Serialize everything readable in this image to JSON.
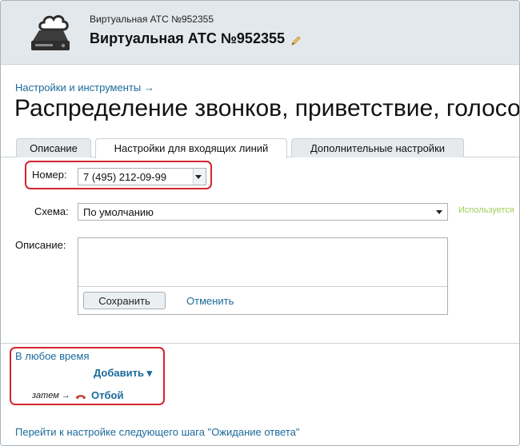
{
  "header": {
    "subtitle": "Виртуальная АТС №952355",
    "title": "Виртуальная АТС №952355"
  },
  "breadcrumb": "Настройки и инструменты →",
  "page_title": "Распределение звонков, приветствие, голосовое меню",
  "tabs": [
    {
      "label": "Описание",
      "active": false
    },
    {
      "label": "Настройки для входящих линий",
      "active": true
    },
    {
      "label": "Дополнительные настройки",
      "active": false
    }
  ],
  "form": {
    "number_label": "Номер:",
    "number_value": "7 (495) 212-09-99",
    "scheme_label": "Схема:",
    "scheme_value": "По умолчанию",
    "scheme_hint": "Используется",
    "description_label": "Описание:",
    "save_label": "Сохранить",
    "cancel_label": "Отменить"
  },
  "rules": {
    "anytime_label": "В любое время",
    "add_label": "Добавить ▾",
    "then_label": "затем →",
    "hangup_label": "Отбой"
  },
  "next_step_link": "Перейти к настройке следующего шага \"Ожидание ответа\"",
  "colors": {
    "accent_link": "#1b6a9a",
    "highlight_box": "#d4242f",
    "hint_text": "#9fce5a",
    "header_bg": "#e3e8ec",
    "phone_icon": "#c0392b"
  },
  "icons": {
    "logo": "cloud-server-icon",
    "edit": "pencil-icon",
    "phone": "phone-hangup-icon"
  }
}
